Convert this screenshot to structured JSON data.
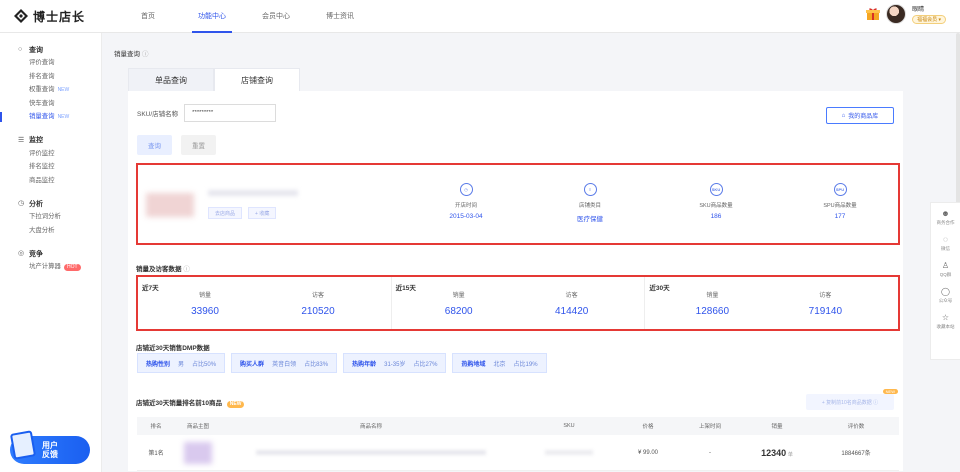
{
  "header": {
    "logo_text": "博士店长",
    "nav": [
      "首页",
      "功能中心",
      "会员中心",
      "博士资讯"
    ],
    "nav_active_index": 1,
    "user_name": "眼睛",
    "user_badge": "福福会员 ▾"
  },
  "sidebar": {
    "groups": [
      {
        "title": "查询",
        "icon": "search-icon",
        "items": [
          {
            "label": "评价查询"
          },
          {
            "label": "排名查询"
          },
          {
            "label": "权重查询",
            "tag": "NEW"
          },
          {
            "label": "快车查询"
          },
          {
            "label": "销量查询",
            "tag": "NEW",
            "active": true
          }
        ]
      },
      {
        "title": "监控",
        "icon": "monitor-icon",
        "items": [
          {
            "label": "评价监控"
          },
          {
            "label": "排名监控"
          },
          {
            "label": "商品监控"
          }
        ]
      },
      {
        "title": "分析",
        "icon": "clock-icon",
        "items": [
          {
            "label": "下拉词分析"
          },
          {
            "label": "大盘分析"
          }
        ]
      },
      {
        "title": "竞争",
        "icon": "target-icon",
        "items": [
          {
            "label": "坑产计算器",
            "hot": "HOT"
          }
        ]
      }
    ],
    "feedback": "用户\n反馈"
  },
  "page": {
    "title": "销量查询",
    "tabs": [
      "单品查询",
      "店铺查询"
    ],
    "active_tab": 1,
    "query": {
      "label": "SKU/店铺名称",
      "value": "*********",
      "query_btn": "查询",
      "reset_btn": "重置",
      "my_store_btn": "我的商品库"
    },
    "store": {
      "btn_shop": "去店商品",
      "btn_fav": "+ 收藏",
      "metrics": [
        {
          "label": "开店时间",
          "value": "2015-03-04",
          "icon": "clock-icon"
        },
        {
          "label": "店铺类目",
          "value": "医疗保健",
          "icon": "list-icon"
        },
        {
          "label": "SKU商品数量",
          "value": "186",
          "icon": "sku-icon",
          "icon_text": "SKU"
        },
        {
          "label": "SPU商品数量",
          "value": "177",
          "icon": "spu-icon",
          "icon_text": "SPU"
        }
      ]
    },
    "sales_section_title": "销量及访客数据",
    "periods": [
      {
        "name": "近7天",
        "sales_label": "销量",
        "sales": "33960",
        "visit_label": "访客",
        "visits": "210520"
      },
      {
        "name": "近15天",
        "sales_label": "销量",
        "sales": "68200",
        "visit_label": "访客",
        "visits": "414420"
      },
      {
        "name": "近30天",
        "sales_label": "销量",
        "sales": "128660",
        "visit_label": "访客",
        "visits": "719140"
      }
    ],
    "dmp_title": "店铺近30天销售DMP数据",
    "dmp": [
      {
        "name": "热购性别",
        "value": "男",
        "ratio": "占比50%"
      },
      {
        "name": "购买人群",
        "value": "英音白领",
        "ratio": "占比83%"
      },
      {
        "name": "热购年龄",
        "value": "31-35岁",
        "ratio": "占比27%"
      },
      {
        "name": "热购地域",
        "value": "北京",
        "ratio": "占比19%"
      }
    ],
    "top10_title": "店铺近30天销量排名前10商品",
    "top10_tag": "NEW",
    "copy_btn": "+ 复制前10名商品数据 ⓘ",
    "copy_tag": "NEW",
    "table": {
      "headers": [
        "排名",
        "商品主图",
        "商品名称",
        "SKU",
        "价格",
        "上架时间",
        "销量",
        "评价数"
      ],
      "rows": [
        {
          "rank": "第1名",
          "price": "¥ 99.00",
          "shelf": "-",
          "sales": "12340",
          "sales_unit": "单",
          "reviews": "1884667条"
        }
      ]
    }
  },
  "float_panel": [
    "商务合作",
    "微信",
    "QQ群",
    "公众号",
    "收藏本站"
  ]
}
